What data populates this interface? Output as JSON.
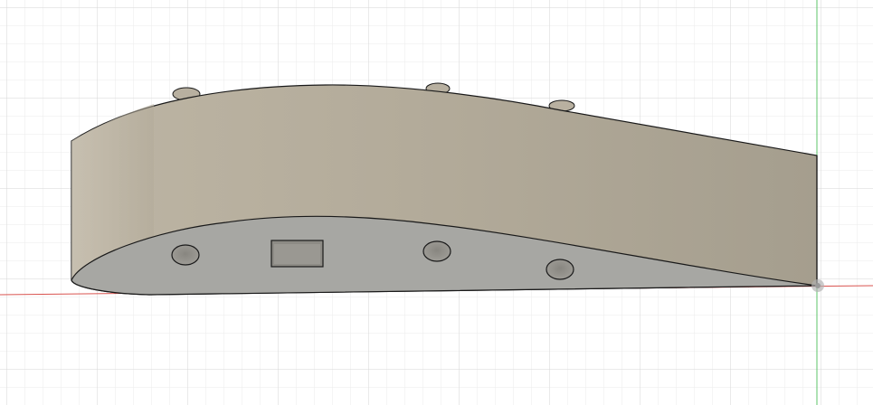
{
  "viewport": {
    "label": "",
    "grid_visible": true
  },
  "colors": {
    "background": "#ffffff",
    "grid_minor": "#ebebeb",
    "grid_major": "#d6d6d6",
    "x_axis": "#d9534f",
    "y_axis": "#5cc46a",
    "wing_side": "#b2aa99",
    "wing_face": "#a7a7a3",
    "edge": "#1a1a1a",
    "origin_marker": "#b0b0b0"
  },
  "model": {
    "name": "",
    "feature_count": {
      "top_bumps": 3,
      "face_holes": 3,
      "rectangular_cutouts": 1
    }
  }
}
